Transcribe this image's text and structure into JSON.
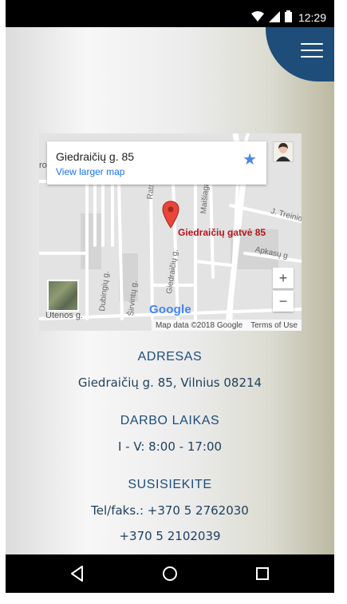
{
  "status_bar": {
    "time": "12:29"
  },
  "map": {
    "place_title": "Giedraičių g. 85",
    "view_larger": "View larger map",
    "pin_label": "Giedraičių gatvė 85",
    "streets": [
      "Maišiaga",
      "Ratnyčios g.",
      "Giedraičių g.",
      "Dubingių g.",
      "Širvintų g.",
      "J. Treinio g",
      "Apkasų g",
      "Utenos g."
    ],
    "partial_text": "ro",
    "zoom_in": "+",
    "zoom_out": "−",
    "google_logo": "Google",
    "map_data": "Map data ©2018 Google",
    "terms": "Terms of Use"
  },
  "address": {
    "heading": "ADRESAS",
    "value": "Giedraičių g. 85, Vilnius 08214"
  },
  "hours": {
    "heading": "DARBO LAIKAS",
    "value": "I - V: 8:00 - 17:00"
  },
  "contact": {
    "heading": "SUSISIEKITE",
    "phone": "Tel/faks.: +370 5 2762030",
    "phone2": "+370 5 2102039"
  },
  "colors": {
    "accent": "#1e4d7a",
    "pin": "#e8453c"
  }
}
